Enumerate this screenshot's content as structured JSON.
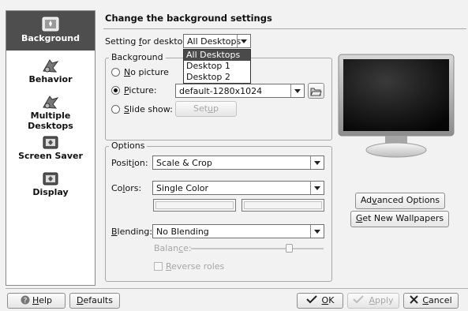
{
  "sidebar": {
    "items": [
      {
        "label": "Background",
        "icon": "background-icon",
        "selected": true
      },
      {
        "label": "Behavior",
        "icon": "behavior-icon"
      },
      {
        "label": "Multiple Desktops",
        "icon": "multiple-desktops-icon"
      },
      {
        "label": "Screen Saver",
        "icon": "screen-saver-icon"
      },
      {
        "label": "Display",
        "icon": "display-icon"
      }
    ]
  },
  "header": {
    "title": "Change the background settings"
  },
  "desktop_setting": {
    "label_pre": "Setting ",
    "label_u": "f",
    "label_post": "or desktop:",
    "value": "All Desktops",
    "options": [
      "All Desktops",
      "Desktop 1",
      "Desktop 2"
    ]
  },
  "background_group": {
    "title": "Background",
    "no_picture": {
      "u": "N",
      "rest": "o picture"
    },
    "picture": {
      "u": "P",
      "rest": "icture:",
      "value": "default-1280x1024"
    },
    "slide_show": {
      "u": "S",
      "rest": "lide show:",
      "setup_pre": "Set",
      "setup_u": "u",
      "setup_post": "p"
    }
  },
  "options_group": {
    "title": "Options",
    "position": {
      "pre": "Posit",
      "u": "i",
      "post": "on:",
      "value": "Scale & Crop"
    },
    "colors": {
      "pre": "Co",
      "u": "l",
      "post": "ors:",
      "value": "Single Color"
    },
    "blending": {
      "pre": "",
      "u": "B",
      "post": "lending:",
      "value": "No Blending"
    },
    "balance": {
      "pre": "Balan",
      "u": "c",
      "post": "e:",
      "level": 0.75
    },
    "reverse": {
      "u": "R",
      "rest": "everse roles"
    }
  },
  "side_buttons": {
    "advanced": {
      "pre": "Ad",
      "u": "v",
      "post": "anced Options"
    },
    "wallpapers": {
      "u": "G",
      "post": "et New Wallpapers"
    }
  },
  "footer": {
    "help": {
      "u": "H",
      "post": "elp"
    },
    "defaults": {
      "u": "D",
      "post": "efaults"
    },
    "ok": {
      "u": "O",
      "post": "K"
    },
    "apply": {
      "u": "A",
      "post": "pply"
    },
    "cancel": {
      "u": "C",
      "post": "ancel"
    }
  }
}
